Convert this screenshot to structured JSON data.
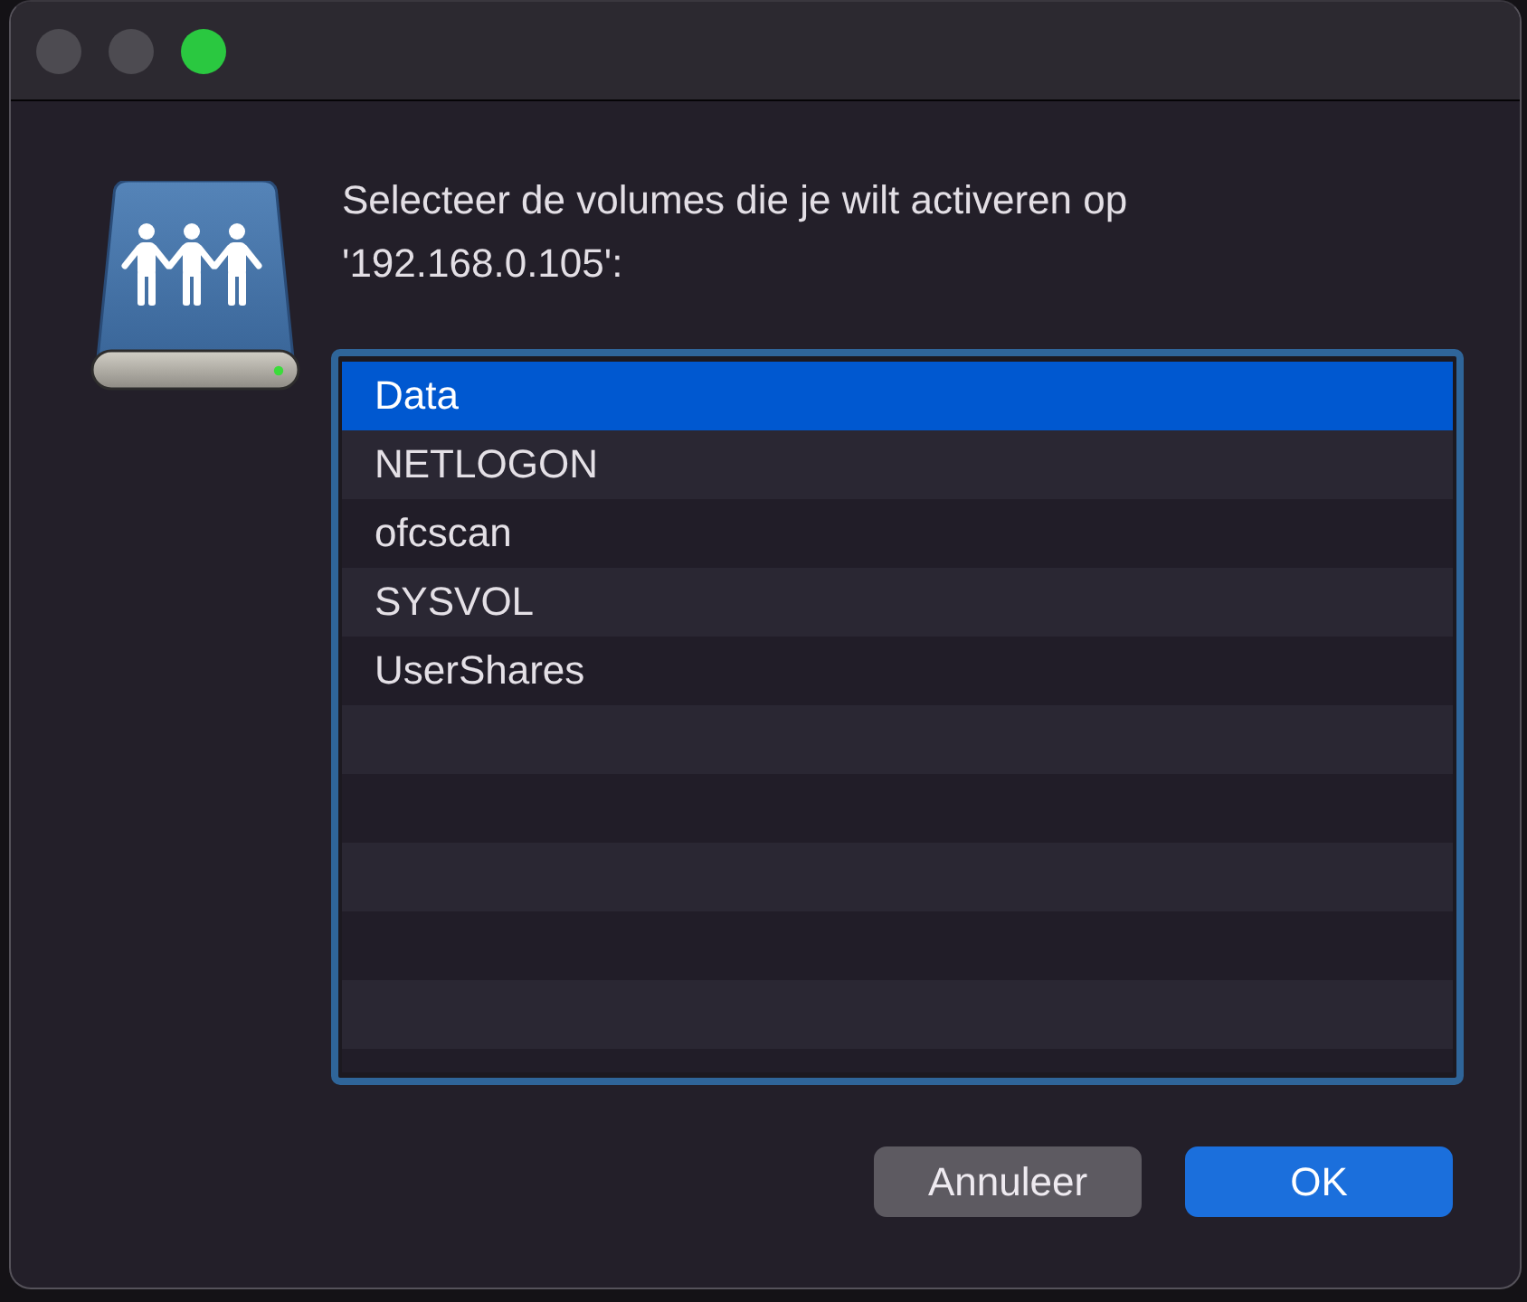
{
  "window": {
    "traffic_lights": [
      {
        "color": "#4d4b51"
      },
      {
        "color": "#4d4b51"
      },
      {
        "color": "#2ac840"
      }
    ]
  },
  "dialog": {
    "message": "Selecteer de volumes die je wilt activeren op '192.168.0.105':"
  },
  "volumes": [
    {
      "name": "Data",
      "selected": true
    },
    {
      "name": "NETLOGON",
      "selected": false
    },
    {
      "name": "ofcscan",
      "selected": false
    },
    {
      "name": "SYSVOL",
      "selected": false
    },
    {
      "name": "UserShares",
      "selected": false
    }
  ],
  "buttons": [
    {
      "label": "Annuleer",
      "kind": "secondary"
    },
    {
      "label": "OK",
      "kind": "default"
    }
  ]
}
